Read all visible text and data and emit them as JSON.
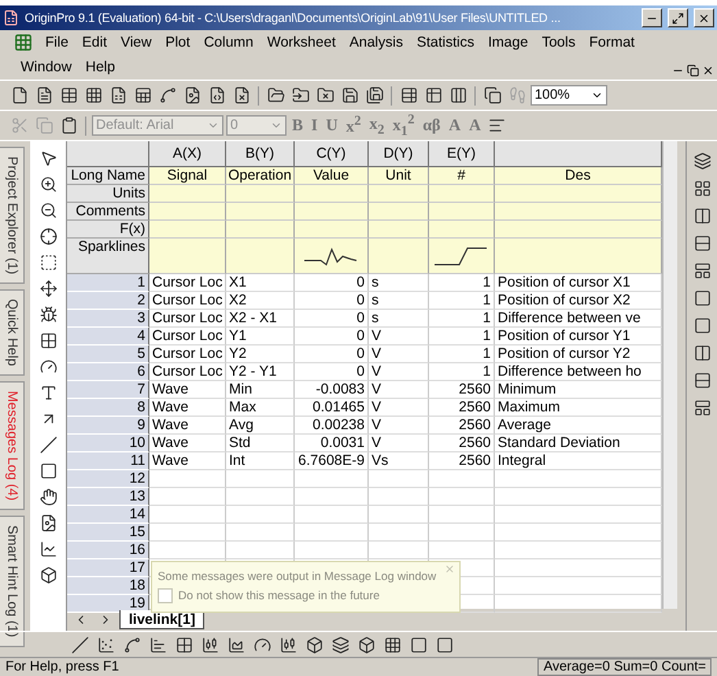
{
  "window": {
    "title": "OriginPro 9.1 (Evaluation) 64-bit - C:\\Users\\draganl\\Documents\\OriginLab\\91\\User Files\\UNTITLED ..."
  },
  "menu": [
    "File",
    "Edit",
    "View",
    "Plot",
    "Column",
    "Worksheet",
    "Analysis",
    "Statistics",
    "Image",
    "Tools",
    "Format",
    "Window",
    "Help"
  ],
  "toolbar": {
    "zoom": "100%",
    "font": "Default: Arial",
    "font_size": "0",
    "format_buttons": [
      "B",
      "I",
      "U",
      "x$^{2}$",
      "x$_{2}$",
      "x$_{1}$$^{2}$",
      "αβ",
      "A",
      "A"
    ]
  },
  "side_tabs": [
    {
      "label": "Project Explorer (1)",
      "alert": false
    },
    {
      "label": "Quick Help",
      "alert": false
    },
    {
      "label": "Messages Log (4)",
      "alert": true
    },
    {
      "label": "Smart Hint Log (1)",
      "alert": false
    }
  ],
  "worksheet": {
    "columns": [
      {
        "header": "A(X)",
        "long_name": "Signal",
        "sparkline": false
      },
      {
        "header": "B(Y)",
        "long_name": "Operation",
        "sparkline": false
      },
      {
        "header": "C(Y)",
        "long_name": "Value",
        "sparkline": true
      },
      {
        "header": "D(Y)",
        "long_name": "Unit",
        "sparkline": false
      },
      {
        "header": "E(Y)",
        "long_name": "#",
        "sparkline": true
      },
      {
        "long_name": "Des",
        "sparkline": false
      }
    ],
    "label_rows": [
      "Long Name",
      "Units",
      "Comments",
      "F(x)",
      "Sparklines"
    ],
    "rows": [
      {
        "n": "1",
        "cells": [
          "Cursor Loc",
          "X1",
          "0",
          "s",
          "1",
          "Position of cursor X1"
        ]
      },
      {
        "n": "2",
        "cells": [
          "Cursor Loc",
          "X2",
          "0",
          "s",
          "1",
          "Position of cursor X2"
        ]
      },
      {
        "n": "3",
        "cells": [
          "Cursor Loc",
          "X2 - X1",
          "0",
          "s",
          "1",
          "Difference between ve"
        ]
      },
      {
        "n": "4",
        "cells": [
          "Cursor Loc",
          "Y1",
          "0",
          "V",
          "1",
          "Position of cursor Y1"
        ]
      },
      {
        "n": "5",
        "cells": [
          "Cursor Loc",
          "Y2",
          "0",
          "V",
          "1",
          "Position of cursor Y2"
        ]
      },
      {
        "n": "6",
        "cells": [
          "Cursor Loc",
          "Y2 - Y1",
          "0",
          "V",
          "1",
          "Difference between ho"
        ]
      },
      {
        "n": "7",
        "cells": [
          "Wave",
          "Min",
          "-0.0083",
          "V",
          "2560",
          "Minimum"
        ]
      },
      {
        "n": "8",
        "cells": [
          "Wave",
          "Max",
          "0.01465",
          "V",
          "2560",
          "Maximum"
        ]
      },
      {
        "n": "9",
        "cells": [
          "Wave",
          "Avg",
          "0.00238",
          "V",
          "2560",
          "Average"
        ]
      },
      {
        "n": "10",
        "cells": [
          "Wave",
          "Std",
          "0.0031",
          "V",
          "2560",
          "Standard Deviation"
        ]
      },
      {
        "n": "11",
        "cells": [
          "Wave",
          "Int",
          "6.7608E-9",
          "Vs",
          "2560",
          "Integral"
        ]
      },
      {
        "n": "12"
      },
      {
        "n": "13"
      },
      {
        "n": "14"
      },
      {
        "n": "15"
      },
      {
        "n": "16"
      },
      {
        "n": "17"
      },
      {
        "n": "18"
      },
      {
        "n": "19"
      }
    ],
    "sheet_tab": "livelink[1]"
  },
  "message": {
    "text": "Some messages were output in Message Log window",
    "checkbox": "Do not show this message in the future",
    "checked": false
  },
  "status_bar": {
    "left": "For Help, press F1",
    "right": "Average=0 Sum=0 Count="
  }
}
